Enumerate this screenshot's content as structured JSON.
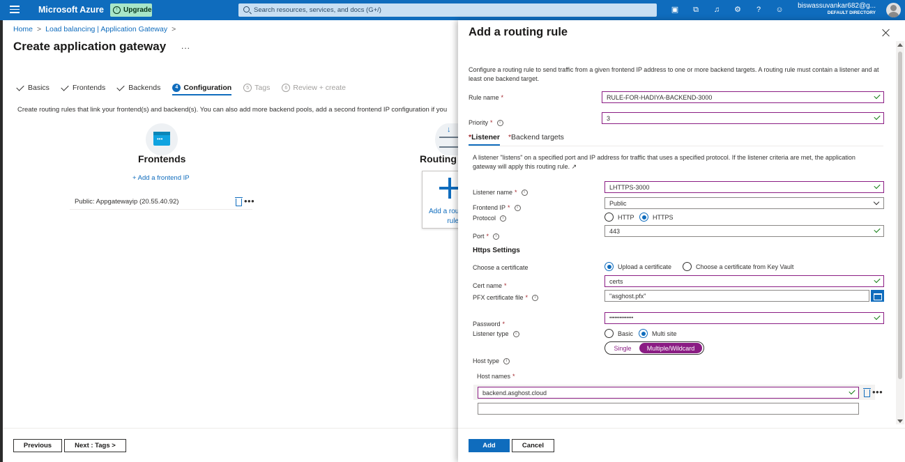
{
  "topbar": {
    "brand": "Microsoft Azure",
    "upgrade_label": "Upgrade",
    "search_placeholder": "Search resources, services, and docs (G+/)",
    "user_name": "biswassuvankar682@g...",
    "user_directory": "DEFAULT DIRECTORY",
    "icons": [
      "cloud-shell-icon",
      "directory-filter-icon",
      "bell-icon",
      "gear-icon",
      "help-icon",
      "feedback-icon"
    ]
  },
  "breadcrumb": {
    "items": [
      "Home",
      "Load balancing | Application Gateway"
    ],
    "separator": ">"
  },
  "page": {
    "title": "Create application gateway",
    "more": "...",
    "steps": [
      {
        "label": "Basics",
        "state": "done"
      },
      {
        "label": "Frontends",
        "state": "done"
      },
      {
        "label": "Backends",
        "state": "done"
      },
      {
        "num": "4",
        "label": "Configuration",
        "state": "active"
      },
      {
        "num": "5",
        "label": "Tags",
        "state": "disabled"
      },
      {
        "num": "6",
        "label": "Review + create",
        "state": "disabled"
      }
    ],
    "intro": "Create routing rules that link your frontend(s) and backend(s). You can also add more backend pools, add a second frontend IP configuration if you",
    "frontends_title": "Frontends",
    "add_frontend": "+ Add a frontend IP",
    "frontend_item": "Public: Appgatewayip (20.55.40.92)",
    "routing_title": "Routing",
    "routing_card_line1": "Add a rou",
    "routing_card_line2": "rule",
    "prev_button": "Previous",
    "next_button": "Next : Tags >"
  },
  "panel": {
    "title": "Add a routing rule",
    "description": "Configure a routing rule to send traffic from a given frontend IP address to one or more backend targets. A routing rule must contain a listener and at least one backend target.",
    "rule_name_label": "Rule name",
    "rule_name_value": "RULE-FOR-HADIYA-BACKEND-3000",
    "priority_label": "Priority",
    "priority_value": "3",
    "tabs": [
      "Listener",
      "Backend targets"
    ],
    "listener_desc": "A listener \"listens\" on a specified port and IP address for traffic that uses a specified protocol. If the listener criteria are met, the application gateway will apply this routing rule.",
    "listener_name_label": "Listener name",
    "listener_name_value": "LHTTPS-3000",
    "frontend_ip_label": "Frontend IP",
    "frontend_ip_value": "Public",
    "protocol_label": "Protocol",
    "protocol_options": [
      "HTTP",
      "HTTPS"
    ],
    "protocol_selected": "HTTPS",
    "port_label": "Port",
    "port_value": "443",
    "https_heading": "Https Settings",
    "choose_cert_label": "Choose a certificate",
    "cert_options": [
      "Upload a certificate",
      "Choose a certificate from Key Vault"
    ],
    "cert_selected": "Upload a certificate",
    "cert_name_label": "Cert name",
    "cert_name_value": "certs",
    "pfx_label": "PFX certificate file",
    "pfx_value": "\"asghost.pfx\"",
    "password_label": "Password",
    "password_value": "••••••••••••••",
    "listener_type_label": "Listener type",
    "listener_type_options": [
      "Basic",
      "Multi site"
    ],
    "listener_type_selected": "Multi site",
    "host_type_options": [
      "Single",
      "Multiple/Wildcard"
    ],
    "host_type_selected": "Multiple/Wildcard",
    "host_type_label": "Host type",
    "host_names_label": "Host names",
    "host_name_value": "backend.asghost.cloud",
    "host_name_empty": "",
    "add_button": "Add",
    "cancel_button": "Cancel"
  },
  "colors": {
    "brand_blue": "#0f6cbd",
    "valid_border": "#8a1c83",
    "ok_green": "#107c10",
    "required_red": "#a4262c"
  }
}
